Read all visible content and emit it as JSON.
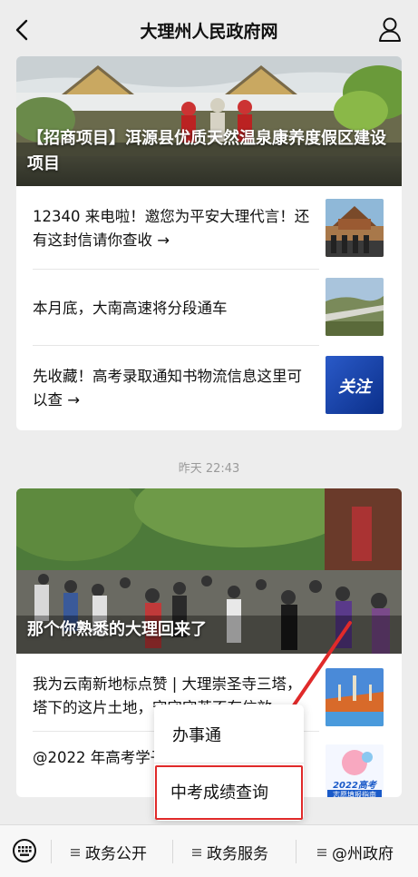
{
  "nav": {
    "title": "大理州人民政府网"
  },
  "card1": {
    "hero_title": "【招商项目】洱源县优质天然温泉康养度假区建设项目",
    "items": [
      {
        "text": "12340 来电啦！邀您为平安大理代言！还有这封信请你查收 →"
      },
      {
        "text": "本月底，大南高速将分段通车"
      },
      {
        "text": "先收藏！高考录取通知书物流信息这里可以查 →",
        "thumb_label": "关注"
      }
    ]
  },
  "timestamp": "昨天 22:43",
  "card2": {
    "hero_title": "那个你熟悉的大理回来了",
    "items": [
      {
        "text": "我为云南新地标点赞 | 大理崇圣寺三塔，塔下的这片土地，守守守苦不有信效"
      },
      {
        "text": "@2022 年高考学子，话公布！另有干货",
        "thumb_label_1": "2022高考",
        "thumb_label_2": "志愿填报指南"
      }
    ]
  },
  "popup": {
    "items": [
      "办事通",
      "中考成绩查询"
    ]
  },
  "bottom": {
    "tabs": [
      "政务公开",
      "政务服务",
      "@州政府"
    ]
  },
  "colors": {
    "accent_red": "#e02a2a",
    "background": "#ededed"
  }
}
